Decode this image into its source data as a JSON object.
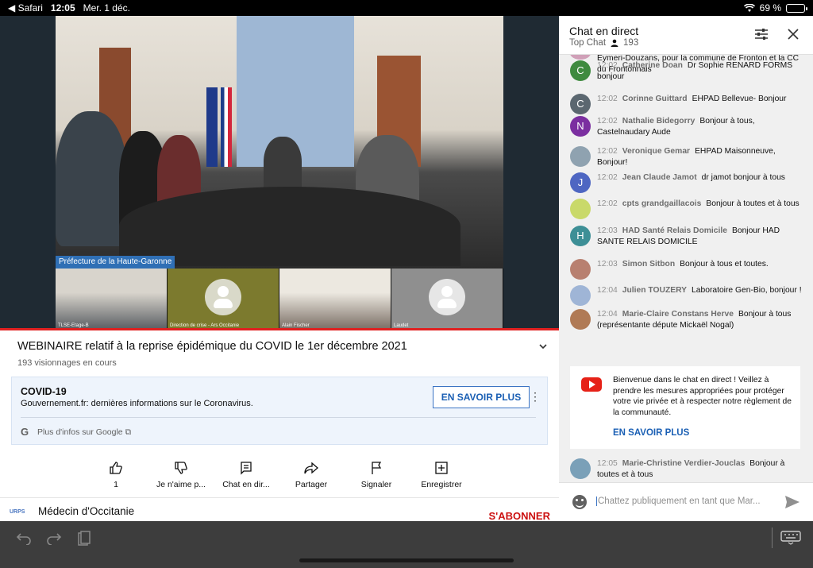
{
  "status_bar": {
    "back_app": "◀ Safari",
    "time": "12:05",
    "date": "Mer. 1 déc.",
    "battery": "69 %",
    "battery_level": 0.69
  },
  "video": {
    "main_caption": "Préfecture de la Haute-Garonne",
    "thumbnails": [
      "TLSE-Etage-B",
      "Direction de crise - Ars Occitanie",
      "Alain Fischer",
      "Laudet"
    ],
    "progress": 1.0
  },
  "info": {
    "title": "WEBINAIRE relatif à la reprise épidémique du COVID le 1er décembre 2021",
    "views": "193 visionnages en cours"
  },
  "covid_panel": {
    "title": "COVID-19",
    "subtitle": "Gouvernement.fr: dernières informations sur le Coronavirus.",
    "button": "EN SAVOIR PLUS",
    "google_link": "Plus d'infos sur Google"
  },
  "actions": [
    {
      "icon": "like-icon",
      "label": "1"
    },
    {
      "icon": "dislike-icon",
      "label": "Je n'aime p..."
    },
    {
      "icon": "chat-icon",
      "label": "Chat en dir..."
    },
    {
      "icon": "share-icon",
      "label": "Partager"
    },
    {
      "icon": "flag-icon",
      "label": "Signaler"
    },
    {
      "icon": "save-icon",
      "label": "Enregistrer"
    }
  ],
  "channel": {
    "logo_text": "URPS",
    "name": "Médecin d'Occitanie",
    "subscribe": "S'ABONNER"
  },
  "chat": {
    "title": "Chat en direct",
    "mode": "Top Chat",
    "viewers": "193",
    "top_partial": "Eymeri-Douzans, pour la commune de Fronton et la CC du Frontonnais",
    "messages": [
      {
        "initial": "C",
        "color": "#3f8a3f",
        "time": "12:02",
        "author": "Catherine Doan",
        "text": "Dr Sophie RENARD FORMS bonjour"
      },
      {
        "initial": "C",
        "color": "#5b6770",
        "time": "12:02",
        "author": "Corinne Guittard",
        "text": "EHPAD Bellevue- Bonjour"
      },
      {
        "initial": "N",
        "color": "#7b2fa0",
        "time": "12:02",
        "author": "Nathalie Bidegorry",
        "text": "Bonjour à tous, Castelnaudary Aude"
      },
      {
        "initial": "",
        "color": "#8fa2b0",
        "time": "12:02",
        "author": "Veronique Gemar",
        "text": "EHPAD Maisonneuve, Bonjour!"
      },
      {
        "initial": "J",
        "color": "#4e66c2",
        "time": "12:02",
        "author": "Jean Claude Jamot",
        "text": "dr jamot bonjour à tous"
      },
      {
        "initial": "",
        "color": "#c9d96a",
        "time": "12:02",
        "author": "cpts grandgaillacois",
        "text": "Bonjour à toutes et à tous"
      },
      {
        "initial": "H",
        "color": "#3d8f96",
        "time": "12:03",
        "author": "HAD Santé Relais Domicile",
        "text": "Bonjour HAD SANTE RELAIS DOMICILE"
      },
      {
        "initial": "",
        "color": "#b88070",
        "time": "12:03",
        "author": "Simon Sitbon",
        "text": "Bonjour à tous et toutes."
      },
      {
        "initial": "",
        "color": "#9fb5d6",
        "time": "12:04",
        "author": "Julien TOUZERY",
        "text": "Laboratoire Gen-Bio, bonjour !"
      },
      {
        "initial": "",
        "color": "#b07a55",
        "time": "12:04",
        "author": "Marie-Claire Constans Herve",
        "text": "Bonjour à tous (représentante députe Mickaël Nogal)"
      }
    ],
    "notice": {
      "text": "Bienvenue dans le chat en direct ! Veillez à prendre les mesures appropriées pour protéger votre vie privée et à respecter notre règlement de la communauté.",
      "link": "EN SAVOIR PLUS"
    },
    "last_message": {
      "initial": "",
      "color": "#7aa0b8",
      "time": "12:05",
      "author": "Marie-Christine Verdier-Jouclas",
      "text": "Bonjour à toutes et à tous"
    },
    "input_placeholder": "Chattez publiquement en tant que Mar..."
  }
}
